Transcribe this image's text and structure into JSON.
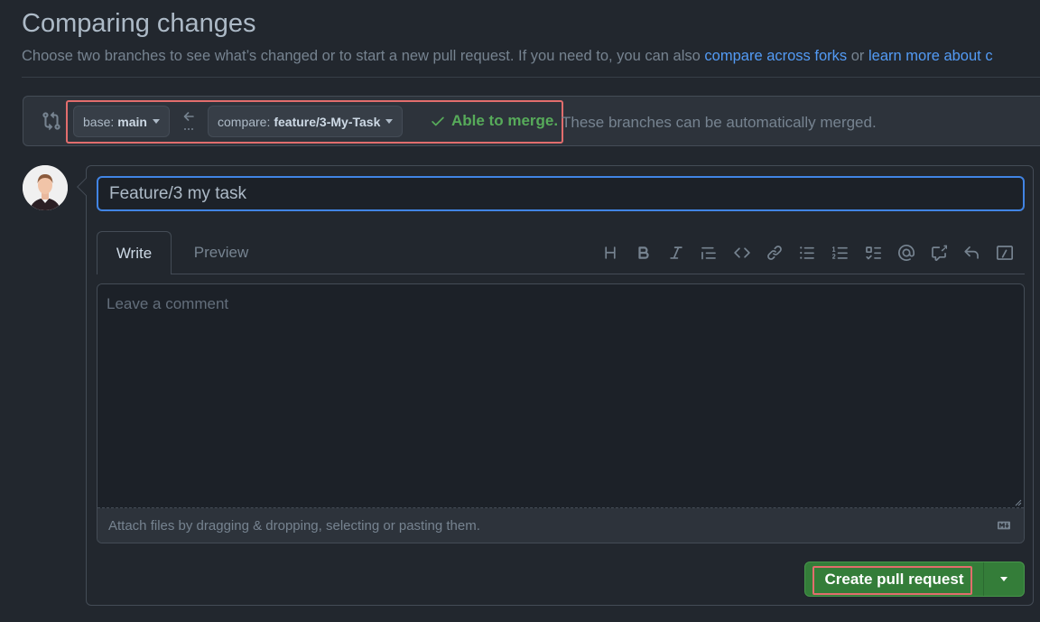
{
  "page": {
    "title": "Comparing changes",
    "subtitle_text": "Choose two branches to see what’s changed or to start a new pull request. If you need to, you can also",
    "link_compare_forks": "compare across forks",
    "subtitle_or": "or",
    "link_learn_more": "learn more about c"
  },
  "range": {
    "base_prefix": "base:",
    "base_branch": "main",
    "compare_prefix": "compare:",
    "compare_branch": "feature/3-My-Task",
    "merge_status": "Able to merge.",
    "merge_note": "These branches can be automatically merged."
  },
  "form": {
    "title_value": "Feature/3 my task",
    "tabs": [
      {
        "label": "Write",
        "active": true
      },
      {
        "label": "Preview",
        "active": false
      }
    ],
    "toolbar_icons": [
      "heading-icon",
      "bold-icon",
      "italic-icon",
      "quote-icon",
      "code-icon",
      "link-icon",
      "unordered-list-icon",
      "ordered-list-icon",
      "task-list-icon",
      "mention-icon",
      "cross-reference-icon",
      "reply-icon",
      "slash-commands-icon"
    ],
    "comment_placeholder": "Leave a comment",
    "attach_hint": "Attach files by dragging & dropping, selecting or pasting them.",
    "submit_label": "Create pull request"
  },
  "colors": {
    "background": "#22272e",
    "accent_link": "#539bf5",
    "success": "#57ab5a",
    "button_green": "#347d39",
    "highlight": "#e26d6d"
  }
}
